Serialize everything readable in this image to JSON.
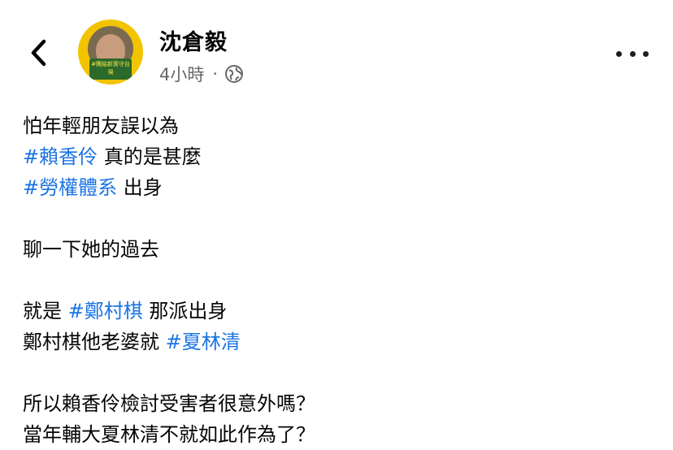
{
  "header": {
    "author_name": "沈倉毅",
    "timestamp": "4小時",
    "separator": "·",
    "privacy_icon": "globe-icon",
    "avatar_badge_text": "#團結新黨守台灣",
    "back_icon": "chevron-left-icon",
    "more_icon": "more-dots-icon"
  },
  "post": {
    "line1": "怕年輕朋友誤以為",
    "line2_tag": "#賴香伶",
    "line2_text": " 真的是甚麼",
    "line3_tag": "#勞權體系",
    "line3_text": " 出身",
    "line4": "聊一下她的過去",
    "line5_text": "就是 ",
    "line5_tag": "#鄭村棋",
    "line5_text2": " 那派出身",
    "line6_text": "鄭村棋他老婆就 ",
    "line6_tag": "#夏林清",
    "line7": "所以賴香伶檢討受害者很意外嗎？",
    "line8": "當年輔大夏林清不就如此作為了？"
  },
  "colors": {
    "hashtag": "#1b74e4",
    "secondary_text": "#65676b",
    "avatar_bg": "#f2c400"
  }
}
